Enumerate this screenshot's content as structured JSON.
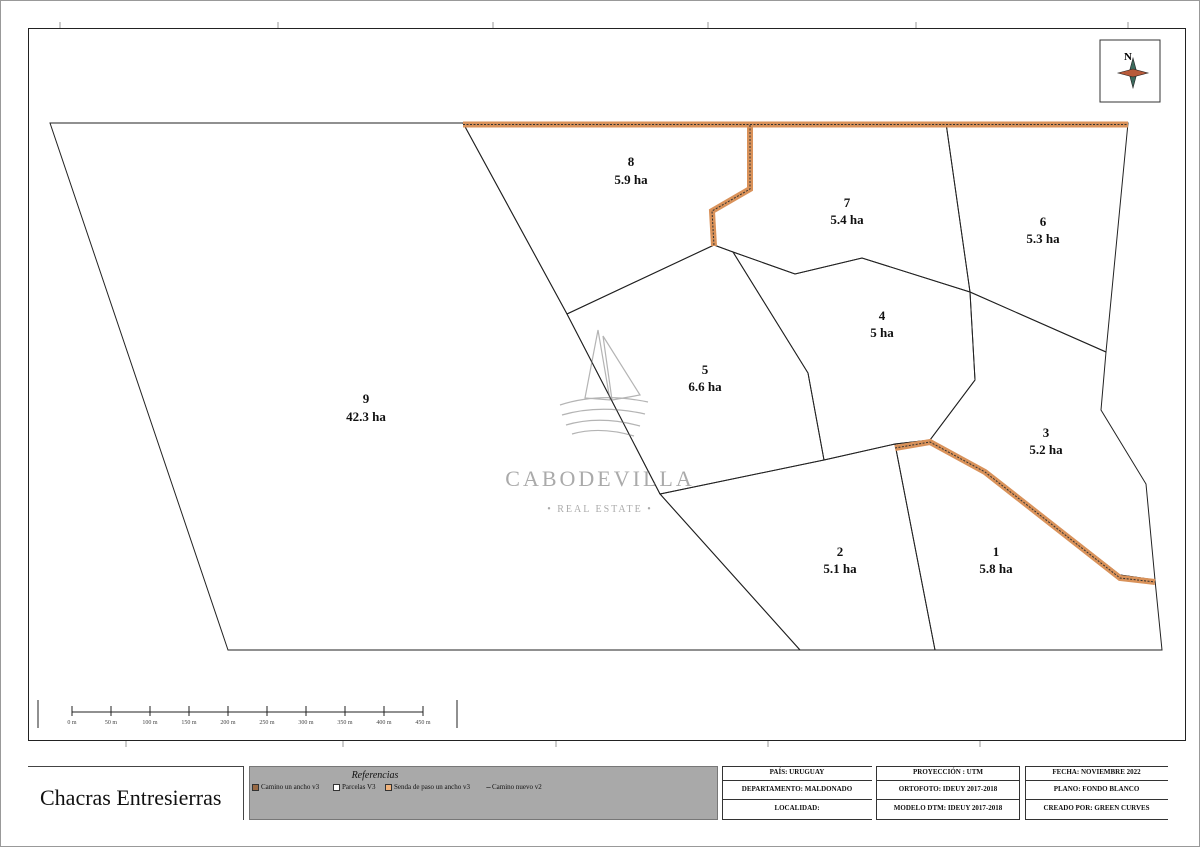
{
  "map": {
    "lots": [
      {
        "number": "1",
        "area": "5.8 ha"
      },
      {
        "number": "2",
        "area": "5.1 ha"
      },
      {
        "number": "3",
        "area": "5.2 ha"
      },
      {
        "number": "4",
        "area": "5 ha"
      },
      {
        "number": "5",
        "area": "6.6 ha"
      },
      {
        "number": "6",
        "area": "5.3 ha"
      },
      {
        "number": "7",
        "area": "5.4 ha"
      },
      {
        "number": "8",
        "area": "5.9 ha"
      },
      {
        "number": "9",
        "area": "42.3 ha"
      }
    ],
    "north_label": "N",
    "watermark": {
      "brand": "CABODEVILLA",
      "tagline": "• REAL ESTATE •"
    },
    "scale_bar": [
      "0 m",
      "50 m",
      "100 m",
      "150 m",
      "200 m",
      "250 m",
      "300 m",
      "350 m",
      "400 m",
      "450 m"
    ],
    "colors": {
      "road": "#d9925a",
      "parcel_line": "#222222",
      "legend_bg": "#a9a9a9"
    }
  },
  "footer": {
    "title": "Chacras Entresierras",
    "references": {
      "title": "Referencias",
      "items": [
        {
          "label": "Camino un ancho v3",
          "color": "#9a6a44"
        },
        {
          "label": "Parcelas V3",
          "color": "#ffffff"
        },
        {
          "label": "Senda de paso un ancho v3",
          "color": "#f0b27a"
        },
        {
          "label": "Camino nuevo v2",
          "color": "none"
        }
      ]
    },
    "info": {
      "pais": "PAÍS: URUGUAY",
      "departamento": "DEPARTAMENTO: MALDONADO",
      "localidad": "LOCALIDAD:",
      "proyeccion": "PROYECCIÓN : UTM",
      "ortofoto": "ORTOFOTO: IDEUY 2017-2018",
      "modelo": "MODELO DTM: IDEUY 2017-2018",
      "fecha": "FECHA: NOVIEMBRE 2022",
      "plano": "PLANO: FONDO BLANCO",
      "creado": "CREADO POR: GREEN CURVES"
    }
  }
}
